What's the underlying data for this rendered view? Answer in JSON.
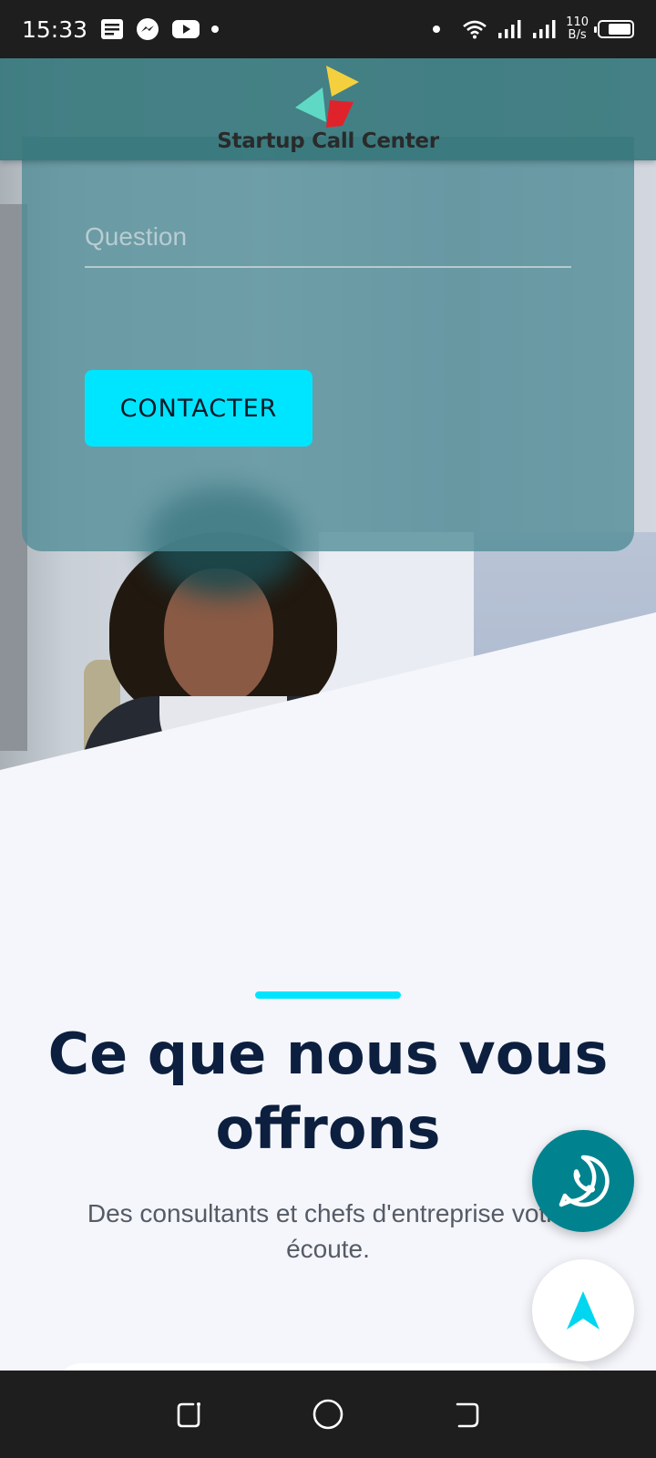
{
  "status_bar": {
    "time": "15:33",
    "net_speed_value": "110",
    "net_speed_unit": "B/s",
    "battery_level": 0.75,
    "icons": [
      "notes-icon",
      "messenger-icon",
      "youtube-icon",
      "dot-icon",
      "dot-icon",
      "wifi-icon",
      "signal-icon",
      "signal-icon",
      "battery-icon"
    ]
  },
  "header": {
    "brand": "Startup Call Center",
    "logo_colors": [
      "#f4d03f",
      "#5fd9c5",
      "#e0232b"
    ]
  },
  "form": {
    "question_placeholder": "Question",
    "question_value": "",
    "contact_label": "CONTACTER"
  },
  "offer": {
    "title": "Ce que nous vous offrons",
    "subtitle": "Des consultants et chefs d'entreprise votre écoute."
  },
  "floating": {
    "whatsapp_icon": "whatsapp-icon",
    "scroll_icon": "navigation-arrow-icon"
  },
  "nav_bar": {
    "icons": [
      "recent-apps-icon",
      "home-icon",
      "back-icon"
    ]
  },
  "colors": {
    "accent": "#00e5ff",
    "title": "#0c1f3f",
    "whatsapp": "#00838f",
    "header": "#37787d"
  }
}
